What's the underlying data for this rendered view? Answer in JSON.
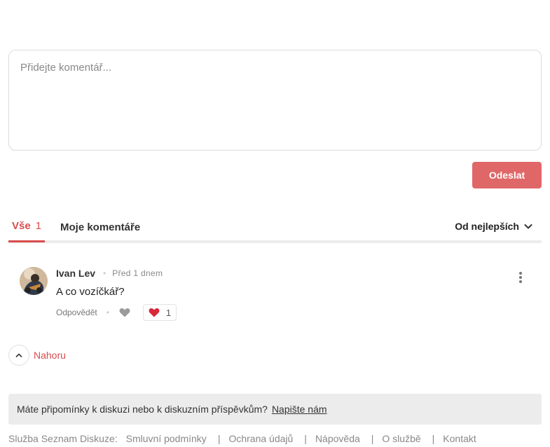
{
  "comment_form": {
    "placeholder": "Přidejte komentář...",
    "submit_label": "Odeslat"
  },
  "tabs": {
    "all_label": "Vše",
    "all_count": "1",
    "mine_label": "Moje komentáře"
  },
  "sort": {
    "selected": "Od nejlepších"
  },
  "comments": [
    {
      "author": "Ivan Lev",
      "time": "Před 1 dnem",
      "text": "A co vozíčkář?",
      "reply_label": "Odpovědět",
      "likes": "1"
    }
  ],
  "back_to_top": "Nahoru",
  "feedback": {
    "text": "Máte připomínky k diskuzi nebo k diskuzním příspěvkům?",
    "link": "Napište nám"
  },
  "footer": {
    "label": "Služba Seznam Diskuze:",
    "links": [
      "Smluvní podmínky",
      "Ochrana údajů",
      "Nápověda",
      "O službě",
      "Kontakt"
    ]
  },
  "colors": {
    "accent": "#d94c4c",
    "button": "#e06767"
  },
  "icons": [
    "heart-outline-icon",
    "heart-filled-icon",
    "chevron-down-icon",
    "chevron-up-icon",
    "more-vertical-icon"
  ]
}
